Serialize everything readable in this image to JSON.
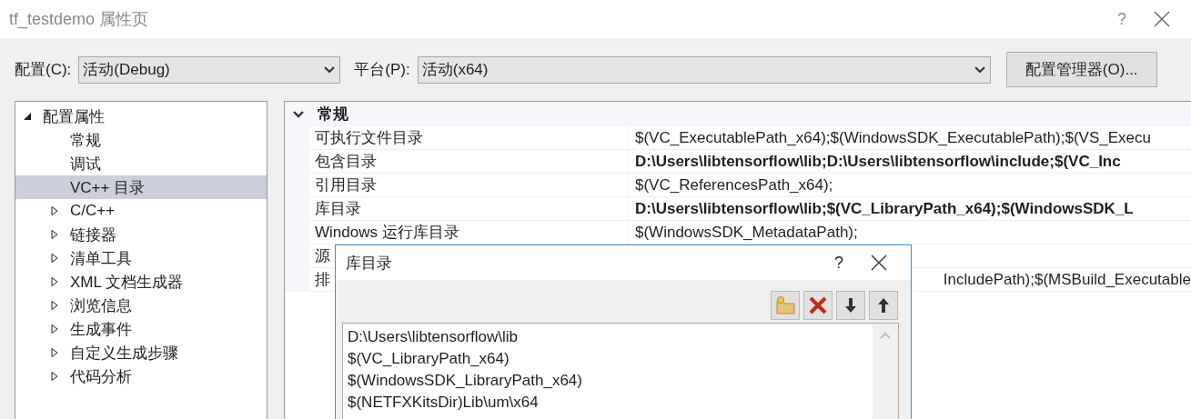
{
  "window": {
    "title": "tf_testdemo 属性页",
    "help": "?"
  },
  "config": {
    "label": "配置(C):",
    "value": "活动(Debug)"
  },
  "platform": {
    "label": "平台(P):",
    "value": "活动(x64)"
  },
  "manager_button": "配置管理器(O)...",
  "tree": [
    {
      "label": "配置属性",
      "kind": "group",
      "expanded": true,
      "selected": false,
      "children": [
        {
          "label": "常规",
          "kind": "leaf",
          "selected": false
        },
        {
          "label": "调试",
          "kind": "leaf",
          "selected": false
        },
        {
          "label": "VC++ 目录",
          "kind": "leaf",
          "selected": true
        },
        {
          "label": "C/C++",
          "kind": "group",
          "expanded": false,
          "selected": false
        },
        {
          "label": "链接器",
          "kind": "group",
          "expanded": false,
          "selected": false
        },
        {
          "label": "清单工具",
          "kind": "group",
          "expanded": false,
          "selected": false
        },
        {
          "label": "XML 文档生成器",
          "kind": "group",
          "expanded": false,
          "selected": false
        },
        {
          "label": "浏览信息",
          "kind": "group",
          "expanded": false,
          "selected": false
        },
        {
          "label": "生成事件",
          "kind": "group",
          "expanded": false,
          "selected": false
        },
        {
          "label": "自定义生成步骤",
          "kind": "group",
          "expanded": false,
          "selected": false
        },
        {
          "label": "代码分析",
          "kind": "group",
          "expanded": false,
          "selected": false
        }
      ]
    }
  ],
  "grid": {
    "category": "常规",
    "expanded": true,
    "rows": [
      {
        "name": "可执行文件目录",
        "value": "$(VC_ExecutablePath_x64);$(WindowsSDK_ExecutablePath);$(VS_Execu",
        "bold": false
      },
      {
        "name": "包含目录",
        "value": "D:\\Users\\libtensorflow\\lib;D:\\Users\\libtensorflow\\include;$(VC_Inc",
        "bold": true
      },
      {
        "name": "引用目录",
        "value": "$(VC_ReferencesPath_x64);",
        "bold": false
      },
      {
        "name": "库目录",
        "value": "D:\\Users\\libtensorflow\\lib;$(VC_LibraryPath_x64);$(WindowsSDK_L",
        "bold": true
      },
      {
        "name": "Windows 运行库目录",
        "value": "$(WindowsSDK_MetadataPath);",
        "bold": false
      },
      {
        "name": "源",
        "bold": false
      },
      {
        "name": "排",
        "value": "IncludePath);$(MSBuild_Executable",
        "bold": false
      }
    ]
  },
  "dialog": {
    "title": "库目录",
    "help": "?",
    "items": [
      "D:\\Users\\libtensorflow\\lib",
      "$(VC_LibraryPath_x64)",
      "$(WindowsSDK_LibraryPath_x64)",
      "$(NETFXKitsDir)Lib\\um\\x64"
    ]
  }
}
